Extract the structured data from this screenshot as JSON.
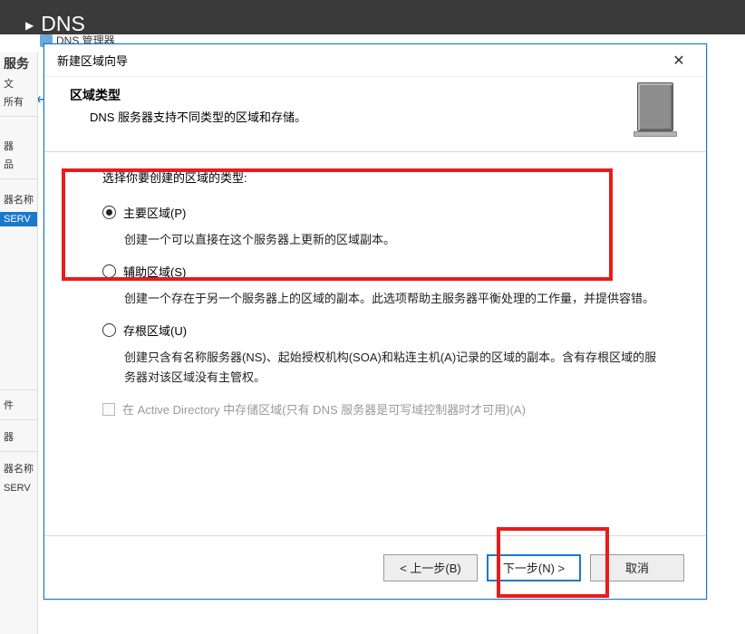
{
  "background": {
    "dark_band_label": "DNS",
    "mgr_title": "DNS 管理器",
    "left": {
      "item1": "服务",
      "item2": "文",
      "item3": "所有",
      "item_srv": "SERV",
      "item_hw": "器",
      "item_pin": "品",
      "item_pnl_name": "器名称",
      "item_events": "件",
      "item_dev": "器",
      "item_name2": "器名称",
      "item_srv2": "SERV"
    }
  },
  "dialog": {
    "title": "新建区域向导",
    "header_title": "区域类型",
    "header_sub": "DNS 服务器支持不同类型的区域和存储。",
    "select_label": "选择你要创建的区域的类型:",
    "options": {
      "primary": {
        "label": "主要区域(P)",
        "desc": "创建一个可以直接在这个服务器上更新的区域副本。"
      },
      "secondary": {
        "label": "辅助区域(S)",
        "desc": "创建一个存在于另一个服务器上的区域的副本。此选项帮助主服务器平衡处理的工作量，并提供容错。"
      },
      "stub": {
        "label": "存根区域(U)",
        "desc": "创建只含有名称服务器(NS)、起始授权机构(SOA)和粘连主机(A)记录的区域的副本。含有存根区域的服务器对该区域没有主管权。"
      }
    },
    "ad_checkbox_label": "在 Active Directory 中存储区域(只有 DNS 服务器是可写域控制器时才可用)(A)",
    "buttons": {
      "back": "< 上一步(B)",
      "next": "下一步(N) >",
      "cancel": "取消"
    }
  }
}
